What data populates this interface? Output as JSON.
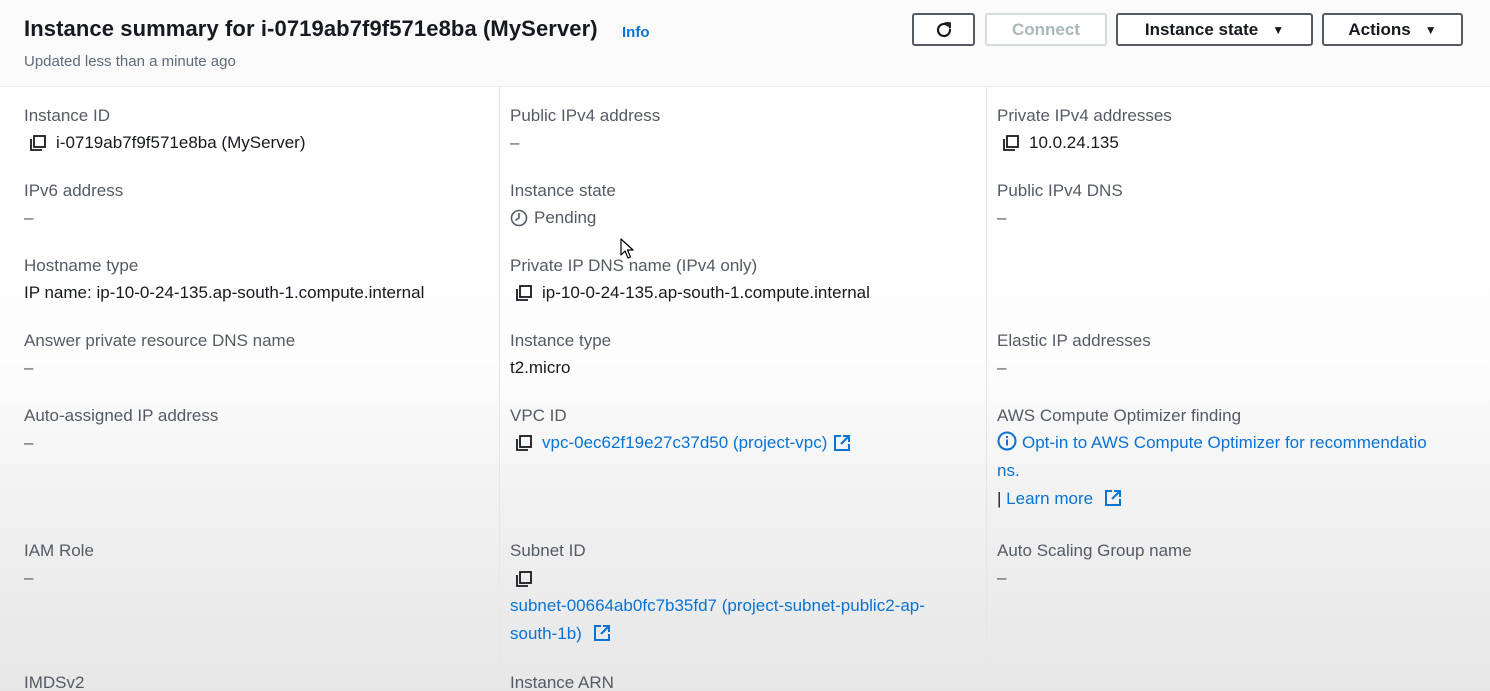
{
  "header": {
    "title": "Instance summary for i-0719ab7f9f571e8ba (MyServer)",
    "info_label": "Info",
    "updated": "Updated less than a minute ago",
    "buttons": {
      "refresh_icon": "refresh-icon",
      "connect": "Connect",
      "instance_state": "Instance state",
      "actions": "Actions"
    }
  },
  "fields": {
    "instance_id": {
      "label": "Instance ID",
      "value": "i-0719ab7f9f571e8ba (MyServer)"
    },
    "public_ipv4": {
      "label": "Public IPv4 address",
      "value": "–"
    },
    "private_ipv4": {
      "label": "Private IPv4 addresses",
      "value": "10.0.24.135"
    },
    "ipv6": {
      "label": "IPv6 address",
      "value": "–"
    },
    "instance_state": {
      "label": "Instance state",
      "value": "Pending"
    },
    "public_dns": {
      "label": "Public IPv4 DNS",
      "value": "–"
    },
    "hostname_type": {
      "label": "Hostname type",
      "value": "IP name: ip-10-0-24-135.ap-south-1.compute.internal"
    },
    "private_dns": {
      "label": "Private IP DNS name (IPv4 only)",
      "value": "ip-10-0-24-135.ap-south-1.compute.internal"
    },
    "answer_dns": {
      "label": "Answer private resource DNS name",
      "value": "–"
    },
    "instance_type": {
      "label": "Instance type",
      "value": "t2.micro"
    },
    "elastic_ip": {
      "label": "Elastic IP addresses",
      "value": "–"
    },
    "auto_ip": {
      "label": "Auto-assigned IP address",
      "value": "–"
    },
    "vpc_id": {
      "label": "VPC ID",
      "value": "vpc-0ec62f19e27c37d50 (project-vpc)"
    },
    "optimizer": {
      "label": "AWS Compute Optimizer finding",
      "line1": "Opt-in to AWS Compute Optimizer for recommendatio",
      "line2": "ns.",
      "separator": "|",
      "learn_more": "Learn more"
    },
    "iam_role": {
      "label": "IAM Role",
      "value": "–"
    },
    "subnet_id": {
      "label": "Subnet ID",
      "line1": "subnet-00664ab0fc7b35fd7 (project-subnet-public2-ap-",
      "line2": "south-1b)"
    },
    "asg_name": {
      "label": "Auto Scaling Group name",
      "value": "–"
    },
    "imdsv2": {
      "label": "IMDSv2"
    },
    "instance_arn": {
      "label": "Instance ARN"
    }
  },
  "colors": {
    "link": "#0972d3",
    "label": "#545b64",
    "text": "#16191f",
    "disabled": "#aab7b8"
  }
}
